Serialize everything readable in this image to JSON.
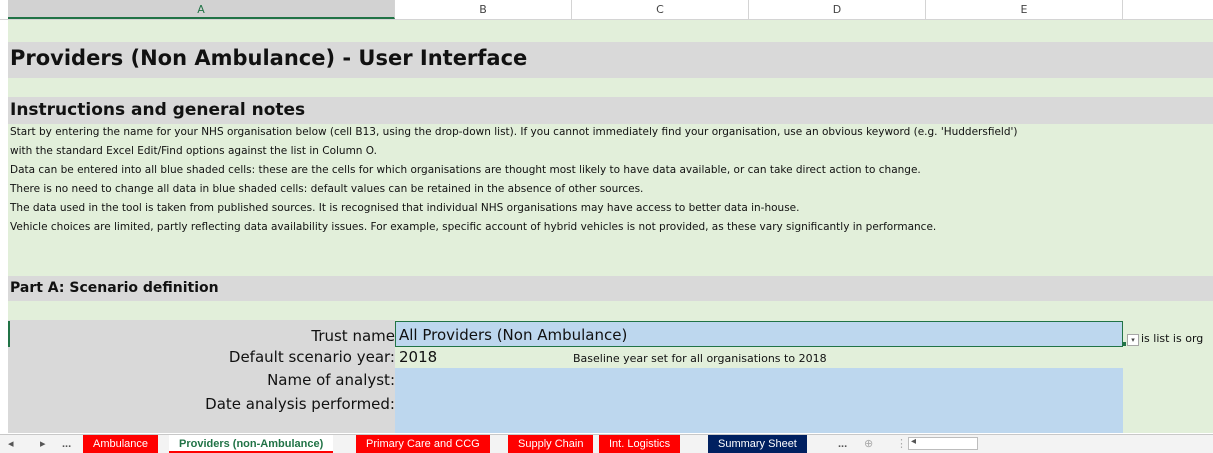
{
  "columns": [
    "A",
    "B",
    "C",
    "D",
    "E"
  ],
  "title": "Providers (Non Ambulance) - User Interface",
  "instructions": {
    "heading": "Instructions and general notes",
    "lines": [
      "Start by entering the name for your NHS organisation below (cell B13, using the drop-down list).  If you cannot immediately find your organisation, use an obvious keyword (e.g. 'Huddersfield')",
      "with the standard Excel Edit/Find options against the list in Column O.",
      "Data can be entered into all blue shaded cells: these are the cells for which organisations are thought most likely to have data available, or can take direct action to change.",
      "There is no need to change all data in blue shaded cells: default values can be retained in the absence of other sources.",
      "The data used in the tool is taken from published sources.  It is recognised that individual NHS organisations may have access to better data in-house.",
      "Vehicle choices are limited, partly reflecting data availability issues.  For example, specific account of hybrid vehicles is not provided, as these vary significantly in performance."
    ]
  },
  "part_a": {
    "heading": "Part A: Scenario definition",
    "trust_label": "Trust name",
    "trust_value": "All Providers (Non Ambulance)",
    "dropdown_hint": "is list is org",
    "year_label": "Default scenario year:",
    "year_value": "2018",
    "year_note": "Baseline year set for all organisations to 2018",
    "analyst_label": "Name of analyst:",
    "analyst_value": "",
    "date_label": "Date analysis performed:",
    "date_value": ""
  },
  "tabs": [
    {
      "label": "Ambulance",
      "color": "#ff0000"
    },
    {
      "label": "Providers (non-Ambulance)",
      "color": "#ffffff",
      "active": true
    },
    {
      "label": "Primary Care and CCG",
      "color": "#ff0000"
    },
    {
      "label": "Supply Chain",
      "color": "#ff0000"
    },
    {
      "label": "Int. Logistics",
      "color": "#ff0000"
    },
    {
      "label": "Summary Sheet",
      "color": "#002060"
    }
  ],
  "nav": {
    "prev": "◂",
    "next": "▸",
    "more_left": "...",
    "more_right": "...",
    "add": "⊕",
    "sep": "⋮",
    "scroll_left": "◂"
  },
  "colors": {
    "sheet_fill": "#e2efda",
    "input_fill": "#bdd7ee",
    "header_fill": "#d9d9d9",
    "accent": "#217346"
  }
}
